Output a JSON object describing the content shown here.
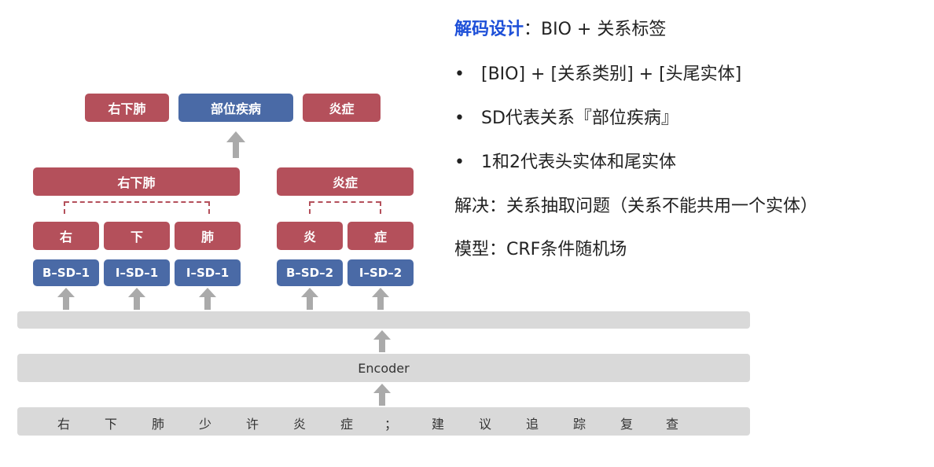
{
  "top_row": [
    "右下肺",
    "部位疾病",
    "炎症"
  ],
  "entity_row": [
    "右下肺",
    "炎症"
  ],
  "char_row": [
    "右",
    "下",
    "肺",
    "炎",
    "症"
  ],
  "tag_row": [
    "B–SD–1",
    "I–SD–1",
    "I–SD–1",
    "B–SD–2",
    "I–SD–2"
  ],
  "encoder_label": "Encoder",
  "tokens": [
    "右",
    "下",
    "肺",
    "少",
    "许",
    "炎",
    "症",
    "；",
    "建",
    "议",
    "追",
    "踪",
    "复",
    "查"
  ],
  "text": {
    "title_highlight": "解码设计",
    "title_rest": "：BIO + 关系标签",
    "bullets": [
      "[BIO] + [关系类别] + [头尾实体]",
      "SD代表关系『部位疾病』",
      "1和2代表头实体和尾实体"
    ],
    "solve": "解决：关系抽取问题（关系不能共用一个实体）",
    "model": "模型：CRF条件随机场"
  }
}
